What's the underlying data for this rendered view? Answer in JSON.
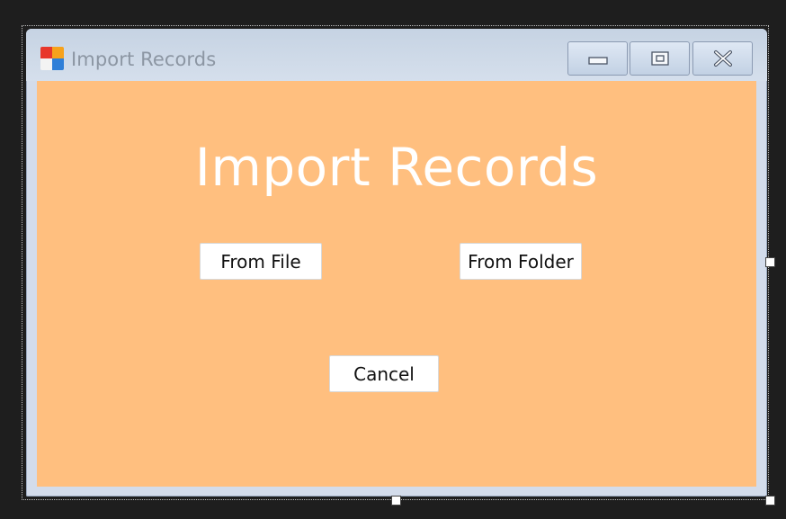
{
  "window": {
    "title": "Import Records",
    "controls": {
      "minimize_icon": "minimize-icon",
      "maximize_icon": "maximize-icon",
      "close_icon": "close-icon"
    }
  },
  "form": {
    "heading": "Import Records",
    "from_file_label": "From File",
    "from_folder_label": "From Folder",
    "cancel_label": "Cancel"
  },
  "colors": {
    "client_background": "#ffbf7f",
    "heading_text": "#ffffff",
    "titlebar": "#c6d3e3",
    "designer_background": "#1e1e1e"
  }
}
